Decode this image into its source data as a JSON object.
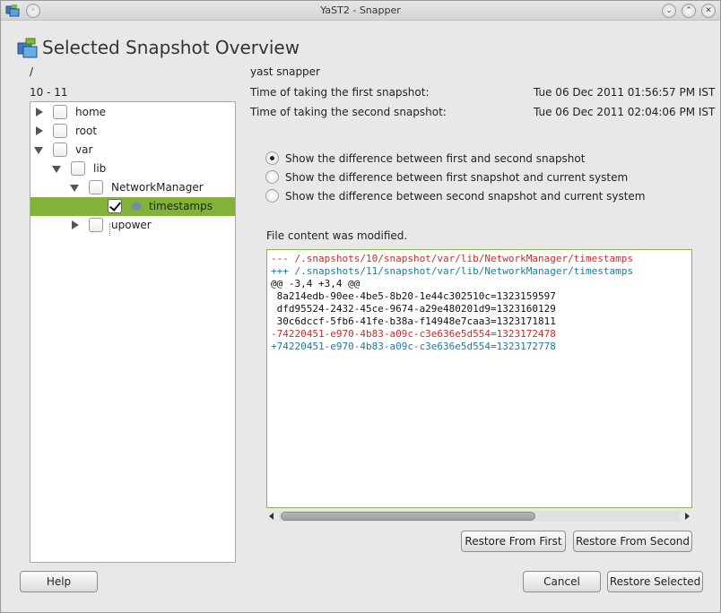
{
  "window": {
    "title": "YaST2 - Snapper"
  },
  "page": {
    "title": "Selected Snapshot Overview"
  },
  "left": {
    "path": "/",
    "range": "10 - 11"
  },
  "info": {
    "snapper_name": "yast snapper",
    "first_label": "Time of taking the first snapshot:",
    "first_value": "Tue 06 Dec 2011 01:56:57 PM IST",
    "second_label": "Time of taking the second snapshot:",
    "second_value": "Tue 06 Dec 2011 02:04:06 PM IST"
  },
  "tree": [
    {
      "label": "home",
      "expanded": false,
      "checked": false,
      "selected": false
    },
    {
      "label": "root",
      "expanded": false,
      "checked": false,
      "selected": false
    },
    {
      "label": "var",
      "expanded": true,
      "checked": false,
      "selected": false
    },
    {
      "label": "lib",
      "expanded": true,
      "checked": false,
      "selected": false
    },
    {
      "label": "NetworkManager",
      "expanded": true,
      "checked": false,
      "selected": false
    },
    {
      "label": "timestamps",
      "checked": true,
      "selected": true
    },
    {
      "label": "upower",
      "expanded": false,
      "checked": false,
      "selected": false
    }
  ],
  "radios": [
    {
      "label": "Show the difference between first and second snapshot",
      "selected": true
    },
    {
      "label": "Show the difference between first snapshot and current system",
      "selected": false
    },
    {
      "label": "Show the difference between second snapshot and current system",
      "selected": false
    }
  ],
  "diff": {
    "status": "File content was modified.",
    "lines": [
      {
        "text": "--- /.snapshots/10/snapshot/var/lib/NetworkManager/timestamps",
        "color": "#c0302c"
      },
      {
        "text": "+++ /.snapshots/11/snapshot/var/lib/NetworkManager/timestamps",
        "color": "#1e7a9c"
      },
      {
        "text": "@@ -3,4 +3,4 @@",
        "color": "#111111"
      },
      {
        "text": " 8a214edb-90ee-4be5-8b20-1e44c302510c=1323159597",
        "color": "#111111"
      },
      {
        "text": " dfd95524-2432-45ce-9674-a29e480201d9=1323160129",
        "color": "#111111"
      },
      {
        "text": " 30c6dccf-5fb6-41fe-b38a-f14948e7caa3=1323171811",
        "color": "#111111"
      },
      {
        "text": "-74220451-e970-4b83-a09c-c3e636e5d554=1323172478",
        "color": "#c0302c"
      },
      {
        "text": "+74220451-e970-4b83-a09c-c3e636e5d554=1323172778",
        "color": "#1e7a9c"
      }
    ]
  },
  "buttons": {
    "restore_first": "Restore From First",
    "restore_second": "Restore From Second",
    "help": "Help",
    "cancel": "Cancel",
    "restore_selected": "Restore Selected"
  },
  "colors": {
    "selection": "#83b23b",
    "minus": "#c0302c",
    "plus": "#1e7a9c"
  },
  "icons": {
    "app": "snapper-app-icon",
    "heading": "snapper-heading-icon",
    "minimize": "minimize-icon",
    "maximize": "maximize-icon",
    "close": "close-icon"
  }
}
